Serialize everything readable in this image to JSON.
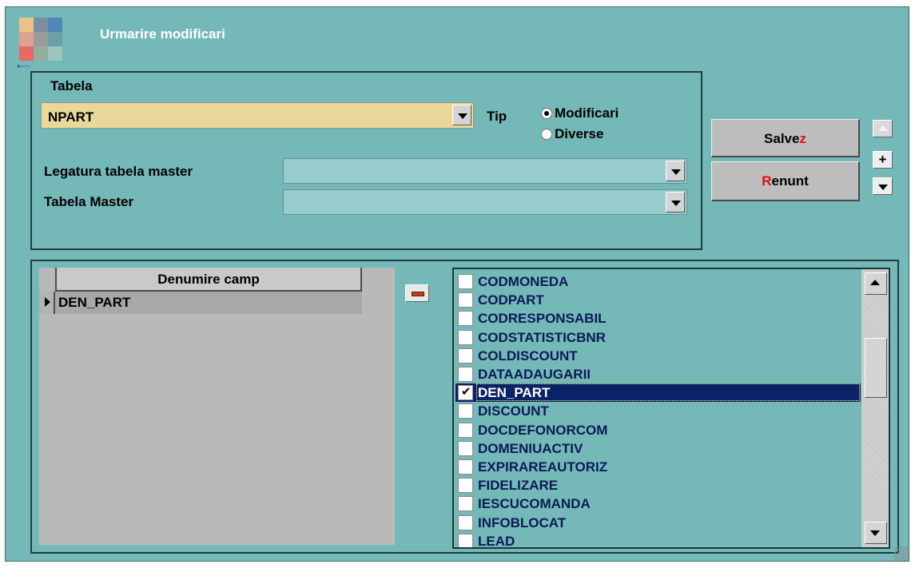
{
  "window": {
    "title": "Urmarire modificari",
    "background_color": "#74b8b8"
  },
  "form": {
    "tabela_label": "Tabela",
    "tabela_value": "NPART",
    "tip_label": "Tip",
    "tip_options": [
      "Modificari",
      "Diverse"
    ],
    "tip_selected": "Modificari",
    "legatura_label": "Legatura tabela master",
    "legatura_value": "",
    "tabela_master_label": "Tabela Master",
    "tabela_master_value": ""
  },
  "buttons": {
    "save_prefix": "Salve",
    "save_hotkey": "z",
    "cancel_hotkey": "R",
    "cancel_suffix": "enunt",
    "plus_label": "+"
  },
  "grid": {
    "header": "Denumire camp",
    "rows": [
      "DEN_PART"
    ]
  },
  "field_list": {
    "items": [
      {
        "name": "CODMONEDA",
        "checked": false
      },
      {
        "name": "CODPART",
        "checked": false
      },
      {
        "name": "CODRESPONSABIL",
        "checked": false
      },
      {
        "name": "CODSTATISTICBNR",
        "checked": false
      },
      {
        "name": "COLDISCOUNT",
        "checked": false
      },
      {
        "name": "DATAADAUGARII",
        "checked": false
      },
      {
        "name": "DEN_PART",
        "checked": true,
        "selected": true
      },
      {
        "name": "DISCOUNT",
        "checked": false
      },
      {
        "name": "DOCDEFONORCOM",
        "checked": false
      },
      {
        "name": "DOMENIUACTIV",
        "checked": false
      },
      {
        "name": "EXPIRAREAUTORIZ",
        "checked": false
      },
      {
        "name": "FIDELIZARE",
        "checked": false
      },
      {
        "name": "IESCUCOMANDA",
        "checked": false
      },
      {
        "name": "INFOBLOCAT",
        "checked": false
      },
      {
        "name": "LEAD",
        "checked": false
      }
    ],
    "checkmark": "✔"
  },
  "icons": {
    "app": "app-grid-icon",
    "dropdown": "chevron-down-icon",
    "scroll_up": "arrow-up-icon",
    "scroll_down": "arrow-down-icon",
    "remove": "minus-icon",
    "add": "plus-icon"
  }
}
